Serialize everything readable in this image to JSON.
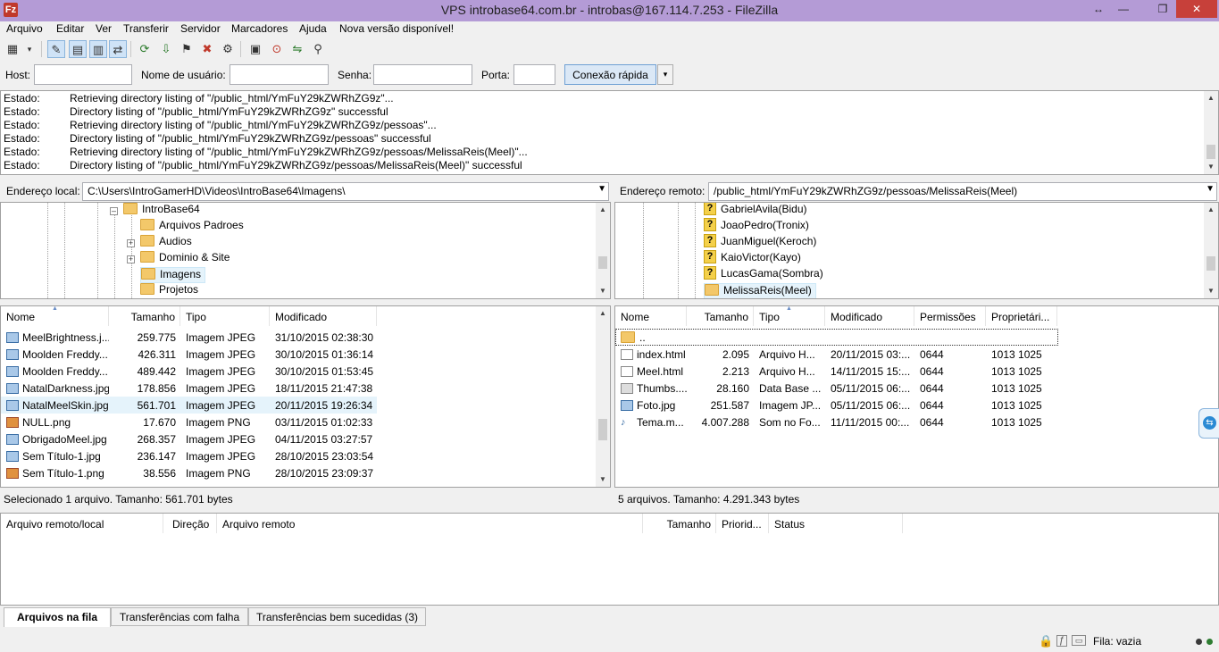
{
  "window": {
    "title": "VPS introbase64.com.br - introbas@167.114.7.253 - FileZilla",
    "icon": "filezilla-icon",
    "controls": [
      "↔",
      "—",
      "❐",
      "✕"
    ]
  },
  "menu": [
    "Arquivo",
    "Editar",
    "Ver",
    "Transferir",
    "Servidor",
    "Marcadores",
    "Ajuda",
    "Nova versão disponível!"
  ],
  "toolbar": {
    "icons": [
      "site-manager-icon",
      "dropdown-icon",
      "toggle-log-icon",
      "toggle-local-tree-icon",
      "toggle-remote-tree-icon",
      "toggle-queue-icon",
      "refresh-icon",
      "process-queue-icon",
      "cancel-icon",
      "disconnect-icon",
      "reconnect-icon",
      "filter-icon",
      "compare-icon",
      "sync-browse-icon",
      "search-icon"
    ]
  },
  "quickconnect": {
    "host_label": "Host:",
    "user_label": "Nome de usuário:",
    "pass_label": "Senha:",
    "port_label": "Porta:",
    "host_value": "",
    "user_value": "",
    "pass_value": "",
    "port_value": "",
    "button": "Conexão rápida",
    "arrow": "▾"
  },
  "log": [
    {
      "k": "Estado:",
      "v": "Retrieving directory listing of \"/public_html/YmFuY29kZWRhZG9z\"..."
    },
    {
      "k": "Estado:",
      "v": "Directory listing of \"/public_html/YmFuY29kZWRhZG9z\" successful"
    },
    {
      "k": "Estado:",
      "v": "Retrieving directory listing of \"/public_html/YmFuY29kZWRhZG9z/pessoas\"..."
    },
    {
      "k": "Estado:",
      "v": "Directory listing of \"/public_html/YmFuY29kZWRhZG9z/pessoas\" successful"
    },
    {
      "k": "Estado:",
      "v": "Retrieving directory listing of \"/public_html/YmFuY29kZWRhZG9z/pessoas/MelissaReis(Meel)\"..."
    },
    {
      "k": "Estado:",
      "v": "Directory listing of \"/public_html/YmFuY29kZWRhZG9z/pessoas/MelissaReis(Meel)\" successful"
    }
  ],
  "local": {
    "addr_label": "Endereço local:",
    "addr_value": "C:\\Users\\IntroGamerHD\\Videos\\IntroBase64\\Imagens\\",
    "tree": [
      "IntroBase64",
      "Arquivos Padroes",
      "Audios",
      "Dominio & Site",
      "Imagens",
      "Projetos"
    ],
    "columns": [
      "Nome",
      "Tamanho",
      "Tipo",
      "Modificado"
    ],
    "files": [
      {
        "name": "MeelBrightness.j...",
        "size": "259.775",
        "type": "Imagem JPEG",
        "mod": "31/10/2015 02:38:30",
        "icon": "jpg"
      },
      {
        "name": "Moolden Freddy...",
        "size": "426.311",
        "type": "Imagem JPEG",
        "mod": "30/10/2015 01:36:14",
        "icon": "jpg"
      },
      {
        "name": "Moolden Freddy...",
        "size": "489.442",
        "type": "Imagem JPEG",
        "mod": "30/10/2015 01:53:45",
        "icon": "jpg"
      },
      {
        "name": "NatalDarkness.jpg",
        "size": "178.856",
        "type": "Imagem JPEG",
        "mod": "18/11/2015 21:47:38",
        "icon": "jpg"
      },
      {
        "name": "NatalMeelSkin.jpg",
        "size": "561.701",
        "type": "Imagem JPEG",
        "mod": "20/11/2015 19:26:34",
        "icon": "jpg"
      },
      {
        "name": "NULL.png",
        "size": "17.670",
        "type": "Imagem PNG",
        "mod": "03/11/2015 01:02:33",
        "icon": "png"
      },
      {
        "name": "ObrigadoMeel.jpg",
        "size": "268.357",
        "type": "Imagem JPEG",
        "mod": "04/11/2015 03:27:57",
        "icon": "jpg"
      },
      {
        "name": "Sem Título-1.jpg",
        "size": "236.147",
        "type": "Imagem JPEG",
        "mod": "28/10/2015 23:03:54",
        "icon": "jpg"
      },
      {
        "name": "Sem Título-1.png",
        "size": "38.556",
        "type": "Imagem PNG",
        "mod": "28/10/2015 23:09:37",
        "icon": "png"
      }
    ],
    "status": "Selecionado 1 arquivo. Tamanho: 561.701 bytes"
  },
  "remote": {
    "addr_label": "Endereço remoto:",
    "addr_value": "/public_html/YmFuY29kZWRhZG9z/pessoas/MelissaReis(Meel)",
    "tree": [
      "GabrielAvila(Bidu)",
      "JoaoPedro(Tronix)",
      "JuanMiguel(Keroch)",
      "KaioVictor(Kayo)",
      "LucasGama(Sombra)",
      "MelissaReis(Meel)"
    ],
    "columns": [
      "Nome",
      "Tamanho",
      "Tipo",
      "Modificado",
      "Permissões",
      "Proprietári..."
    ],
    "parent": "..",
    "files": [
      {
        "name": "index.html",
        "size": "2.095",
        "type": "Arquivo H...",
        "mod": "20/11/2015 03:...",
        "perm": "0644",
        "owner": "1013 1025",
        "icon": "html"
      },
      {
        "name": "Meel.html",
        "size": "2.213",
        "type": "Arquivo H...",
        "mod": "14/11/2015 15:...",
        "perm": "0644",
        "owner": "1013 1025",
        "icon": "html"
      },
      {
        "name": "Thumbs....",
        "size": "28.160",
        "type": "Data Base ...",
        "mod": "05/11/2015 06:...",
        "perm": "0644",
        "owner": "1013 1025",
        "icon": "db"
      },
      {
        "name": "Foto.jpg",
        "size": "251.587",
        "type": "Imagem JP...",
        "mod": "05/11/2015 06:...",
        "perm": "0644",
        "owner": "1013 1025",
        "icon": "jpg"
      },
      {
        "name": "Tema.m...",
        "size": "4.007.288",
        "type": "Som no Fo...",
        "mod": "11/11/2015 00:...",
        "perm": "0644",
        "owner": "1013 1025",
        "icon": "snd"
      }
    ],
    "status": "5 arquivos. Tamanho: 4.291.343 bytes"
  },
  "queue": {
    "columns": [
      "Arquivo remoto/local",
      "Direção",
      "Arquivo remoto",
      "Tamanho",
      "Priorid...",
      "Status"
    ],
    "tabs": [
      "Arquivos na fila",
      "Transferências com falha",
      "Transferências bem sucedidas (3)"
    ]
  },
  "statusbar": {
    "queue": "Fila: vazia"
  }
}
